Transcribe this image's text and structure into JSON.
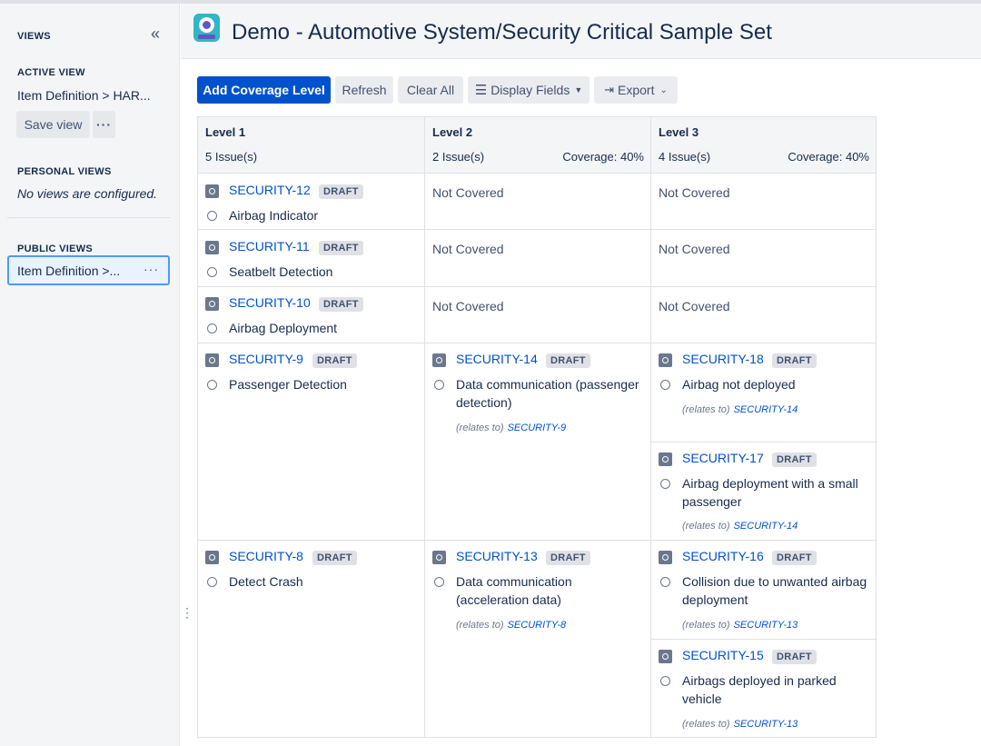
{
  "sidebar": {
    "views_heading": "VIEWS",
    "collapse_icon": "«",
    "active_view_heading": "ACTIVE VIEW",
    "active_view_name": "Item Definition > HAR...",
    "save_view_label": "Save view",
    "more_label": "···",
    "personal_views_heading": "PERSONAL VIEWS",
    "personal_views_empty": "No views are configured.",
    "public_views_heading": "PUBLIC VIEWS",
    "public_view_item": "Item Definition >...",
    "public_more_label": "···"
  },
  "header": {
    "title": "Demo - Automotive System/Security Critical Sample Set",
    "icon": "app-robot-icon"
  },
  "toolbar": {
    "add_coverage_level": "Add Coverage Level",
    "refresh": "Refresh",
    "clear_all": "Clear All",
    "display_fields": "Display Fields",
    "export": "Export"
  },
  "columns": [
    {
      "label": "Level 1",
      "count": "5 Issue(s)",
      "coverage": ""
    },
    {
      "label": "Level 2",
      "count": "2 Issue(s)",
      "coverage": "Coverage: 40%"
    },
    {
      "label": "Level 3",
      "count": "4 Issue(s)",
      "coverage": "Coverage: 40%"
    }
  ],
  "not_covered": "Not Covered",
  "issues": {
    "s12": {
      "key": "SECURITY-12",
      "status": "DRAFT",
      "summary": "Airbag Indicator"
    },
    "s11": {
      "key": "SECURITY-11",
      "status": "DRAFT",
      "summary": "Seatbelt Detection"
    },
    "s10": {
      "key": "SECURITY-10",
      "status": "DRAFT",
      "summary": "Airbag Deployment"
    },
    "s9": {
      "key": "SECURITY-9",
      "status": "DRAFT",
      "summary": "Passenger Detection"
    },
    "s14": {
      "key": "SECURITY-14",
      "status": "DRAFT",
      "summary": "Data communication (passenger detection)",
      "relation": "(relates to)",
      "related": "SECURITY-9"
    },
    "s18": {
      "key": "SECURITY-18",
      "status": "DRAFT",
      "summary": "Airbag not deployed",
      "relation": "(relates to)",
      "related": "SECURITY-14"
    },
    "s17": {
      "key": "SECURITY-17",
      "status": "DRAFT",
      "summary": "Airbag deployment with a small passenger",
      "relation": "(relates to)",
      "related": "SECURITY-14"
    },
    "s8": {
      "key": "SECURITY-8",
      "status": "DRAFT",
      "summary": "Detect Crash"
    },
    "s13": {
      "key": "SECURITY-13",
      "status": "DRAFT",
      "summary": "Data communication (acceleration data)",
      "relation": "(relates to)",
      "related": "SECURITY-8"
    },
    "s16": {
      "key": "SECURITY-16",
      "status": "DRAFT",
      "summary": "Collision due to unwanted airbag deployment",
      "relation": "(relates to)",
      "related": "SECURITY-13"
    },
    "s15": {
      "key": "SECURITY-15",
      "status": "DRAFT",
      "summary": "Airbags deployed in parked vehicle",
      "relation": "(relates to)",
      "related": "SECURITY-13"
    }
  }
}
